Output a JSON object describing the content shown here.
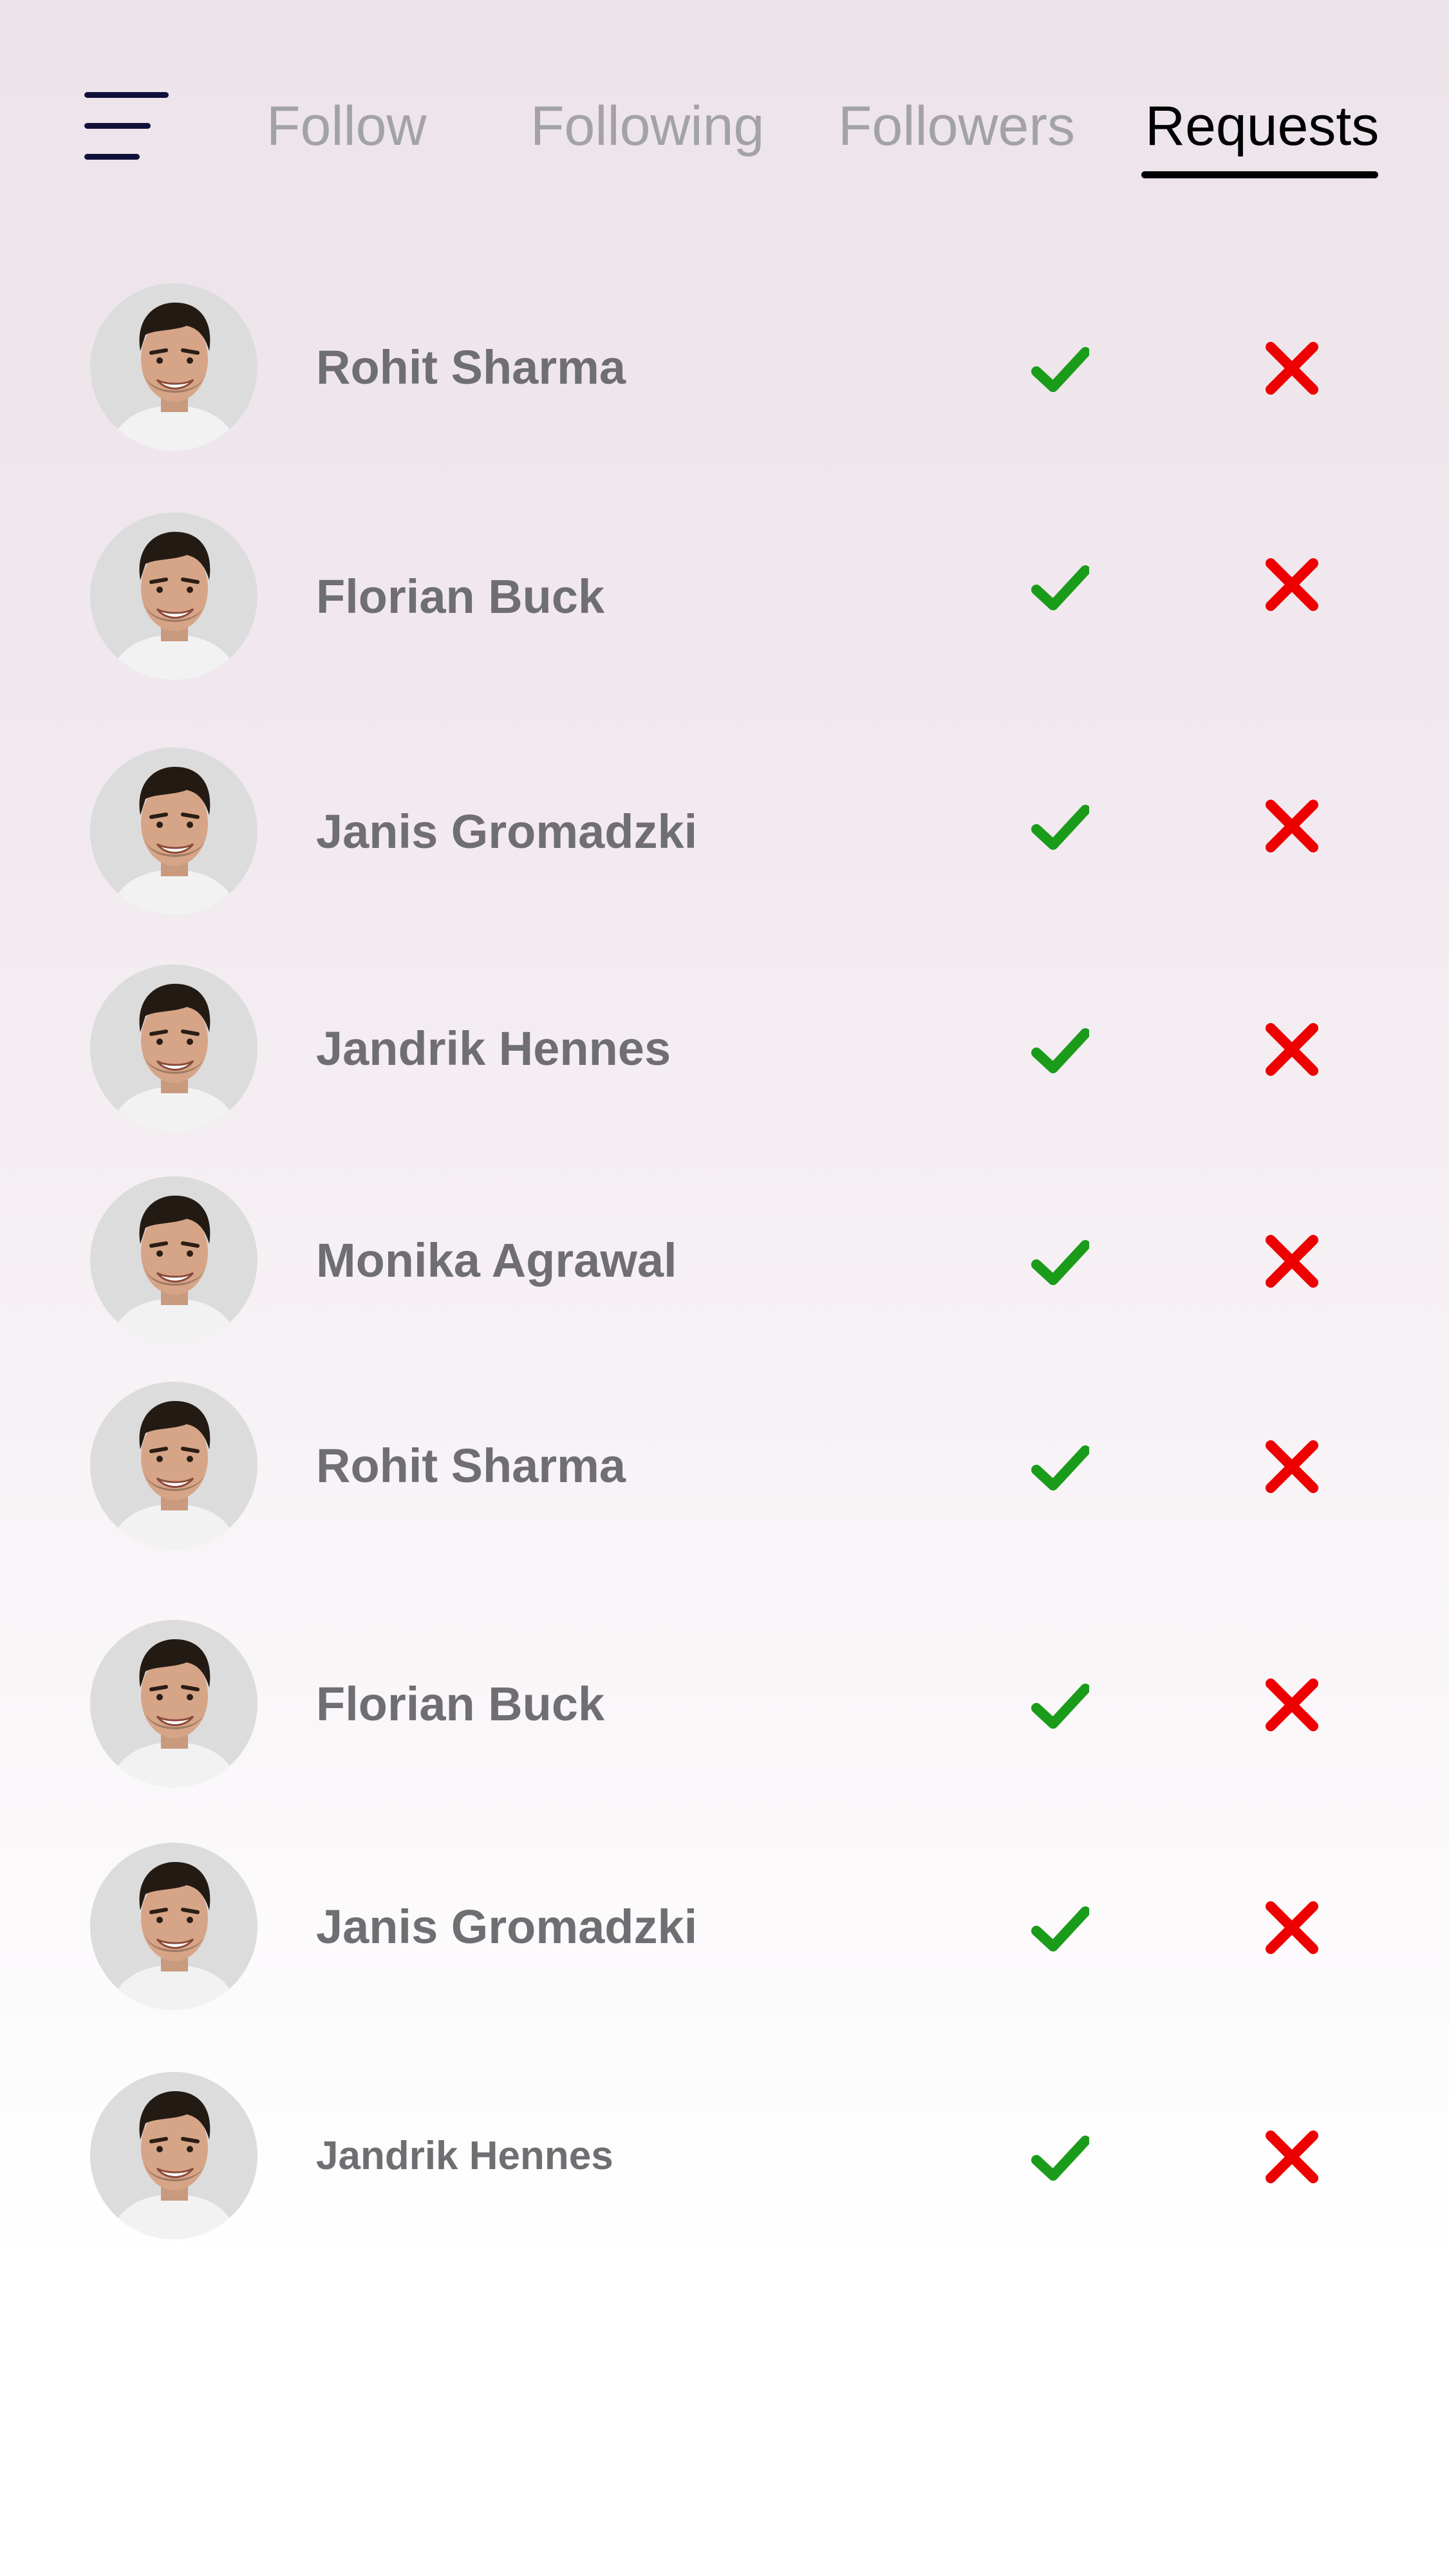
{
  "header": {
    "menu_icon": "hamburger-menu-icon",
    "tabs": [
      {
        "label": "Follow",
        "active": false
      },
      {
        "label": "Following",
        "active": false
      },
      {
        "label": "Followers",
        "active": false
      },
      {
        "label": "Requests",
        "active": true
      }
    ]
  },
  "requests": [
    {
      "name": "Rohit Sharma"
    },
    {
      "name": "Florian Buck"
    },
    {
      "name": "Janis Gromadzki"
    },
    {
      "name": "Jandrik Hennes"
    },
    {
      "name": "Monika Agrawal"
    },
    {
      "name": "Rohit Sharma"
    },
    {
      "name": "Florian Buck"
    },
    {
      "name": "Janis Gromadzki"
    },
    {
      "name": "Jandrik Hennes"
    }
  ],
  "icons": {
    "accept": "checkmark-icon",
    "decline": "cross-icon"
  },
  "colors": {
    "accept": "#1a9c1a",
    "decline": "#ee0000",
    "active_tab": "#000000",
    "inactive_tab": "#a2a2a8",
    "name_text": "#6f6f73",
    "menu_icon": "#10103a"
  }
}
